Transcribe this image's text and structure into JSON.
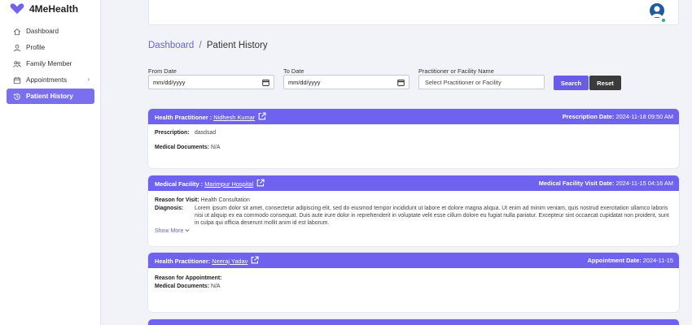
{
  "app": {
    "name": "4MeHealth"
  },
  "sidebar": {
    "items": [
      {
        "label": "Dashboard",
        "icon": "home-icon"
      },
      {
        "label": "Profile",
        "icon": "user-icon"
      },
      {
        "label": "Family Member",
        "icon": "family-icon"
      },
      {
        "label": "Appointments",
        "icon": "calendar-icon"
      },
      {
        "label": "Patient History",
        "icon": "history-icon",
        "active": true
      }
    ]
  },
  "breadcrumb": {
    "root": "Dashboard",
    "separator": "/",
    "current": "Patient History"
  },
  "filters": {
    "from_label": "From Date",
    "from_value": "mm/dd/yyyy",
    "to_label": "To Date",
    "to_value": "mm/dd/yyyy",
    "practitioner_label": "Practitioner or Facility Name",
    "practitioner_placeholder": "Select Practitioner or Facility",
    "search_label": "Search",
    "reset_label": "Reset"
  },
  "records": [
    {
      "head_label": "Health Practitioner :",
      "head_name": "Nidhesh Kumar",
      "date_label": "Prescription Date:",
      "date_value": "2024-11-18 09:50 AM",
      "fields": [
        {
          "label": "Prescription:",
          "value": "dasdsad"
        },
        {
          "label": "Medical Documents:",
          "value": "N/A"
        }
      ]
    },
    {
      "head_label": "Medical Facility :",
      "head_name": "Marimpur Hospital",
      "date_label": "Medical Facility Visit Date:",
      "date_value": "2024-11-15 04:16 AM",
      "reason_label": "Reason for Visit:",
      "reason_value": "Health Consultation",
      "diagnosis_label": "Diagnosis:",
      "diagnosis_value": "Lorem ipsum dolor sit amet, consectetur adipiscing elit, sed do eiusmod tempor incididunt ut labore et dolore magna aliqua. Ut enim ad minim veniam, quis nostrud exercitation ullamco laboris nisi ut aliquip ex ea commodo consequat. Duis aute irure dolor in reprehenderit in voluptate velit esse cillum dolore eu fugiat nulla pariatur. Excepteur sint occaecat cupidatat non proident, sunt in culpa qui officia deserunt mollit anim id est laborum.",
      "show_more": "Show More"
    },
    {
      "head_label": "Health Practitioner:",
      "head_name": "Neeraj Yadav",
      "date_label": "Appointment Date:",
      "date_value": "2024-11-15",
      "fields": [
        {
          "label": "Reason for Appointment:",
          "value": ""
        },
        {
          "label": "Medical Documents:",
          "value": "N/A"
        }
      ]
    }
  ],
  "colors": {
    "accent": "#6f62ee",
    "sidebar_active": "#7b6ff0",
    "reset": "#3b3b3b",
    "online": "#22b573"
  }
}
